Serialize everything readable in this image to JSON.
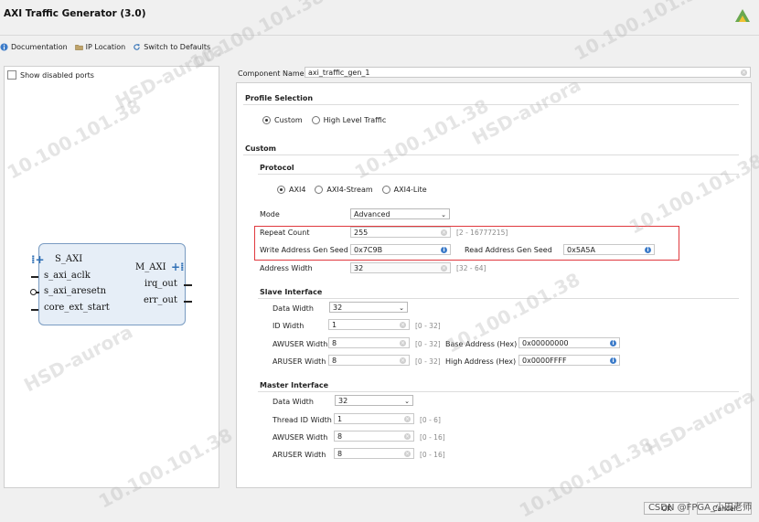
{
  "window": {
    "title": "AXI Traffic Generator (3.0)"
  },
  "toolbar": {
    "documentation": "Documentation",
    "ip_location": "IP Location",
    "switch_defaults": "Switch to Defaults"
  },
  "left": {
    "show_disabled_ports": "Show disabled ports",
    "ports_left": [
      "S_AXI",
      "s_axi_aclk",
      "s_axi_aresetn",
      "core_ext_start"
    ],
    "ports_right": [
      "M_AXI",
      "irq_out",
      "err_out"
    ]
  },
  "component": {
    "label": "Component Name",
    "value": "axi_traffic_gen_1"
  },
  "profile": {
    "heading": "Profile Selection",
    "options": [
      "Custom",
      "High Level Traffic"
    ],
    "selected": "Custom"
  },
  "custom": {
    "heading": "Custom",
    "protocol": {
      "heading": "Protocol",
      "options": [
        "AXI4",
        "AXI4-Stream",
        "AXI4-Lite"
      ],
      "selected": "AXI4"
    },
    "mode": {
      "label": "Mode",
      "value": "Advanced"
    },
    "repeat_count": {
      "label": "Repeat Count",
      "value": "255",
      "range": "[2 - 16777215]"
    },
    "write_seed": {
      "label": "Write Address Gen Seed",
      "value": "0x7C9B"
    },
    "read_seed": {
      "label": "Read Address Gen Seed",
      "value": "0x5A5A"
    },
    "address_width": {
      "label": "Address Width",
      "value": "32",
      "range": "[32 - 64]"
    }
  },
  "slave": {
    "heading": "Slave Interface",
    "data_width": {
      "label": "Data Width",
      "value": "32"
    },
    "id_width": {
      "label": "ID Width",
      "value": "1",
      "range": "[0 - 32]"
    },
    "awuser_width": {
      "label": "AWUSER Width",
      "value": "8",
      "range": "[0 - 32]"
    },
    "aruser_width": {
      "label": "ARUSER Width",
      "value": "8",
      "range": "[0 - 32]"
    },
    "base_address": {
      "label": "Base Address (Hex)",
      "value": "0x00000000"
    },
    "high_address": {
      "label": "High Address (Hex)",
      "value": "0x0000FFFF"
    }
  },
  "master": {
    "heading": "Master Interface",
    "data_width": {
      "label": "Data Width",
      "value": "32"
    },
    "thread_id_width": {
      "label": "Thread ID Width",
      "value": "1",
      "range": "[0 - 6]"
    },
    "awuser_width": {
      "label": "AWUSER Width",
      "value": "8",
      "range": "[0 - 16]"
    },
    "aruser_width": {
      "label": "ARUSER Width",
      "value": "8",
      "range": "[0 - 16]"
    }
  },
  "buttons": {
    "ok": "OK",
    "cancel": "Cancel"
  },
  "watermark": {
    "text": "10.100.101.38",
    "text2": "HSD-aurora"
  },
  "footer": {
    "credit": "CSDN @FPGA_小田老师"
  },
  "colors": {
    "highlight": "#e0393e",
    "accent": "#3d7cc9",
    "block_fill": "#e6eef7"
  }
}
